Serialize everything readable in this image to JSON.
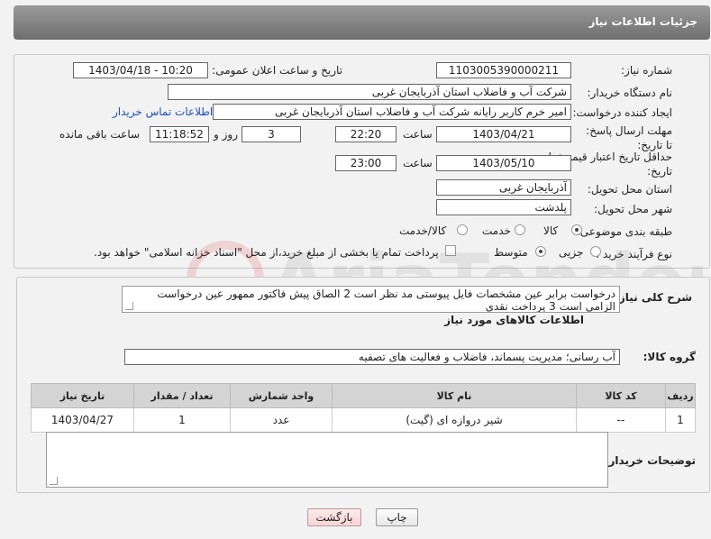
{
  "header": {
    "title": "جزئیات اطلاعات نیاز"
  },
  "form": {
    "need_number_label": "شماره نیاز:",
    "need_number": "1103005390000211",
    "announce_label": "تاریخ و ساعت اعلان عمومی:",
    "announce_value": "1403/04/18 - 10:20",
    "buyer_org_label": "نام دستگاه خریدار:",
    "buyer_org": "شرکت آب و فاضلاب استان آذربایجان غربی",
    "creator_label": "ایجاد کننده درخواست:",
    "creator": "امیر خرم کاربر رایانه شرکت آب و فاضلاب استان آذربایجان غربی",
    "contact_link": "اطلاعات تماس خریدار",
    "reply_deadline_label": "مهلت ارسال پاسخ: تا تاریخ:",
    "reply_date": "1403/04/21",
    "time_label": "ساعت",
    "reply_time": "22:20",
    "days_value": "3",
    "days_label": "روز و",
    "remaining_time": "11:18:52",
    "remaining_label": "ساعت باقی مانده",
    "price_deadline_label": "حداقل تاریخ اعتبار قیمت: تا تاریخ:",
    "price_date": "1403/05/10",
    "price_time": "23:00",
    "province_label": "استان محل تحویل:",
    "province": "آذربایجان غربی",
    "city_label": "شهر محل تحویل:",
    "city": "پلدشت",
    "category_label": "طبقه بندی موضوعی:",
    "category_options": [
      "کالا",
      "خدمت",
      "کالا/خدمت"
    ],
    "process_label": "نوع فرآیند خرید :",
    "process_options": [
      "جزیی",
      "متوسط"
    ],
    "treasury_note": "پرداخت تمام یا بخشی از مبلغ خرید،از محل \"اسناد خزانه اسلامی\" خواهد بود."
  },
  "details": {
    "description_label": "شرح کلی نیاز:",
    "description": "درخواست برابر عین مشخصات فایل پیوستی مد نظر است 2 الصاق پیش فاکتور ممهور عین درخواست الزامی است 3 پرداخت نقدی",
    "goods_info_title": "اطلاعات کالاهای مورد نیاز",
    "goods_group_label": "گروه کالا:",
    "goods_group": "آب رسانی؛ مدیریت پسماند، فاضلاب و فعالیت های تصفیه",
    "table": {
      "headers": [
        "ردیف",
        "کد کالا",
        "نام کالا",
        "واحد شمارش",
        "تعداد / مقدار",
        "تاریخ نیاز"
      ],
      "rows": [
        [
          "1",
          "--",
          "شیر دروازه ای (گیت)",
          "عدد",
          "1",
          "1403/04/27"
        ]
      ]
    },
    "buyer_notes_label": "توضیحات خریدار:",
    "buyer_notes": ""
  },
  "buttons": {
    "print": "چاپ",
    "back": "بازگشت"
  },
  "watermark_text": "AriaTender.net"
}
